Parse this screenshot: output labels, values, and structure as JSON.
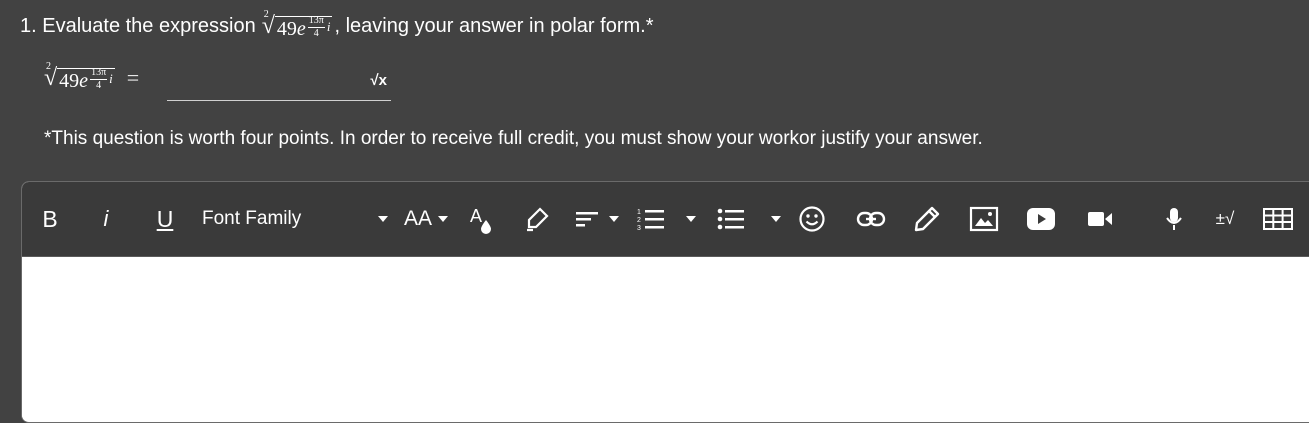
{
  "question": {
    "prefix": "1. Evaluate the expression",
    "suffix": ", leaving your answer in polar form.*",
    "expr": {
      "index": "2",
      "base": "49",
      "e": "e",
      "exp_num": "13π",
      "exp_den": "4",
      "imag": "i"
    }
  },
  "answer_row": {
    "equals": "=",
    "sqrt_button": "√x"
  },
  "note": "*This question is worth four points. In order to receive full credit, you must show your workor justify your answer.",
  "toolbar": {
    "bold": "B",
    "italic": "i",
    "underline": "U",
    "font_family": "Font Family",
    "font_size": "AA",
    "plus_minus_sqrt": "±√"
  }
}
